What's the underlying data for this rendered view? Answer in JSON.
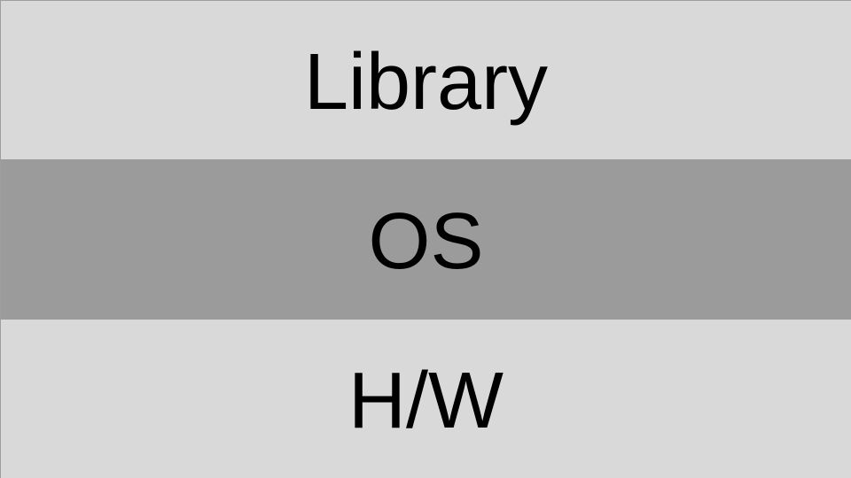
{
  "layers": [
    {
      "label": "Library",
      "color": "#d9d9d9"
    },
    {
      "label": "OS",
      "color": "#9b9b9b"
    },
    {
      "label": "H/W",
      "color": "#d9d9d9"
    }
  ]
}
